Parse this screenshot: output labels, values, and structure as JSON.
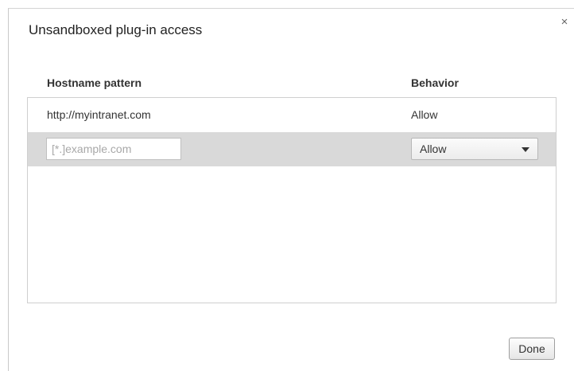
{
  "dialog": {
    "title": "Unsandboxed plug-in access",
    "close_glyph": "×"
  },
  "table": {
    "headers": {
      "hostname": "Hostname pattern",
      "behavior": "Behavior"
    },
    "rows": [
      {
        "hostname": "http://myintranet.com",
        "behavior": "Allow"
      }
    ],
    "new_row": {
      "hostname_placeholder": "[*.]example.com",
      "hostname_value": "",
      "behavior_selected": "Allow"
    }
  },
  "footer": {
    "done_label": "Done"
  },
  "colors": {
    "selected_row_bg": "#d9d9d9",
    "border": "#cfcfcf"
  }
}
